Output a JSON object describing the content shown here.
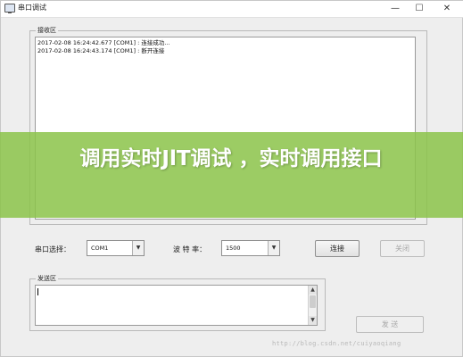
{
  "window": {
    "title": "串口调试",
    "min_glyph": "—",
    "max_glyph": "☐",
    "close_glyph": "✕"
  },
  "receive": {
    "group_title": "接收区",
    "lines": [
      "2017-02-08 16:24:42.677 [COM1] : 连接成功...",
      "2017-02-08 16:24:43.174 [COM1] : 断开连接"
    ]
  },
  "controls": {
    "port_label": "串口选择：",
    "port_value": "COM1",
    "baud_label": "波 特 率：",
    "baud_value": "1500",
    "connect_label": "连接",
    "close_label": "关闭"
  },
  "send": {
    "group_title": "发送区",
    "value": "",
    "send_label": "发 送"
  },
  "watermark": "http://blog.csdn.net/cuiyaoqiang",
  "overlay": {
    "text": "调用实时JlT调试 ，实时调用接口"
  },
  "icons": {
    "app": "window-app-icon",
    "dropdown": "chevron-down-icon",
    "scroll_up": "arrow-up-icon",
    "scroll_down": "arrow-down-icon"
  },
  "colors": {
    "overlay": "#8cc44a",
    "window_bg": "#eeeeee"
  }
}
